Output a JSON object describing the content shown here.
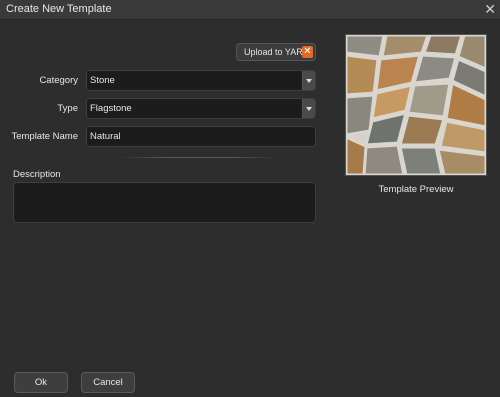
{
  "window": {
    "title": "Create New Template",
    "close_glyph": "✕"
  },
  "upload": {
    "label": "Upload to YARD",
    "close_glyph": "✕"
  },
  "form": {
    "category": {
      "label": "Category",
      "value": "Stone"
    },
    "type": {
      "label": "Type",
      "value": "Flagstone"
    },
    "template_name": {
      "label": "Template Name",
      "value": "Natural"
    },
    "description": {
      "label": "Description",
      "value": ""
    }
  },
  "preview": {
    "caption": "Template Preview"
  },
  "buttons": {
    "ok": "Ok",
    "cancel": "Cancel"
  },
  "colors": {
    "background": "#2d2d2d",
    "titlebar": "#3a3a3a",
    "field_bg": "#1c1c1c",
    "accent_orange": "#e06a24"
  },
  "icons": {
    "close": "close-icon",
    "upload_close": "close-icon",
    "dropdown": "chevron-down-icon"
  }
}
